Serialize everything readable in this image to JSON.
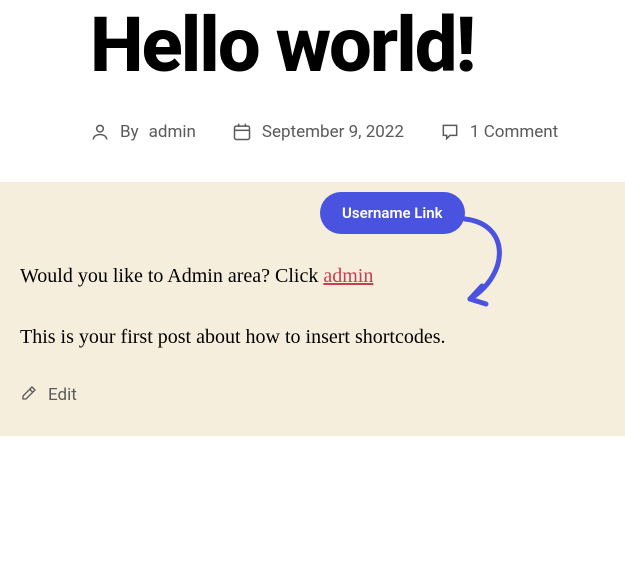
{
  "post": {
    "title": "Hello world!",
    "by_label": "By",
    "author": "admin",
    "date": "September 9, 2022",
    "comments": "1 Comment"
  },
  "content": {
    "paragraph1_prefix": "Would you like to Admin area? Click ",
    "admin_link_text": "admin",
    "paragraph2": "This is your first post about how to insert shortcodes."
  },
  "callout": {
    "label": "Username Link"
  },
  "edit": {
    "label": "Edit"
  }
}
